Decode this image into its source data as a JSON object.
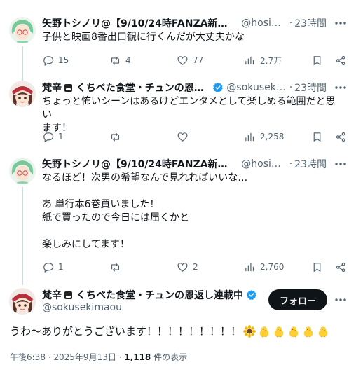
{
  "tweets": [
    {
      "name": "矢野トシノリ@【9/10/24時FANZA新作発…",
      "handle": "@hosim…",
      "time": "23時間",
      "text": "子供と映画8番出口観に行くんだが大丈夫かな",
      "replies": "15",
      "retweets": "4",
      "likes": "77",
      "views": "2.7万"
    },
    {
      "name": "梵辛",
      "name_suffix": "くちべた食堂・チュンの恩返…",
      "handle": "@sokuseki…",
      "time": "23時間",
      "text": "ちょっと怖いシーンはあるけどエンタメとして楽しめる範囲だと思い\nます！",
      "replies": "1",
      "retweets": "",
      "likes": "",
      "views": "2,258"
    },
    {
      "name": "矢野トシノリ@【9/10/24時FANZA新作発…",
      "handle": "@hosim…",
      "time": "23時間",
      "text": "なるほど！次男の希望なんで見れればいいな…\n\nあ 単行本6巻買いました！\n紙で買ったので今日には届くかと\n\n楽しみにしてます！",
      "replies": "1",
      "retweets": "",
      "likes": "2",
      "views": "2,760"
    }
  ],
  "main": {
    "name": "梵辛",
    "name_suffix": "くちべた食堂・チュンの恩返し連載中",
    "handle": "@sokusekimaou",
    "follow_label": "フォロー",
    "text": "うわ〜ありがとうございます！！！！！！！！！",
    "timestamp": "午後6:38 · 2025年9月13日 · ",
    "view_count": "1,118",
    "view_suffix": " 件の表示"
  },
  "colors": {
    "verified": "#1d9bf0",
    "text": "#0f1419",
    "muted": "#536471",
    "thread_line": "#cfd9de"
  },
  "icons": [
    "reply-icon",
    "retweet-icon",
    "like-icon",
    "views-icon",
    "bookmark-icon",
    "share-icon",
    "more-icon",
    "verified-icon",
    "sunflower-emoji",
    "chick-emoji"
  ]
}
